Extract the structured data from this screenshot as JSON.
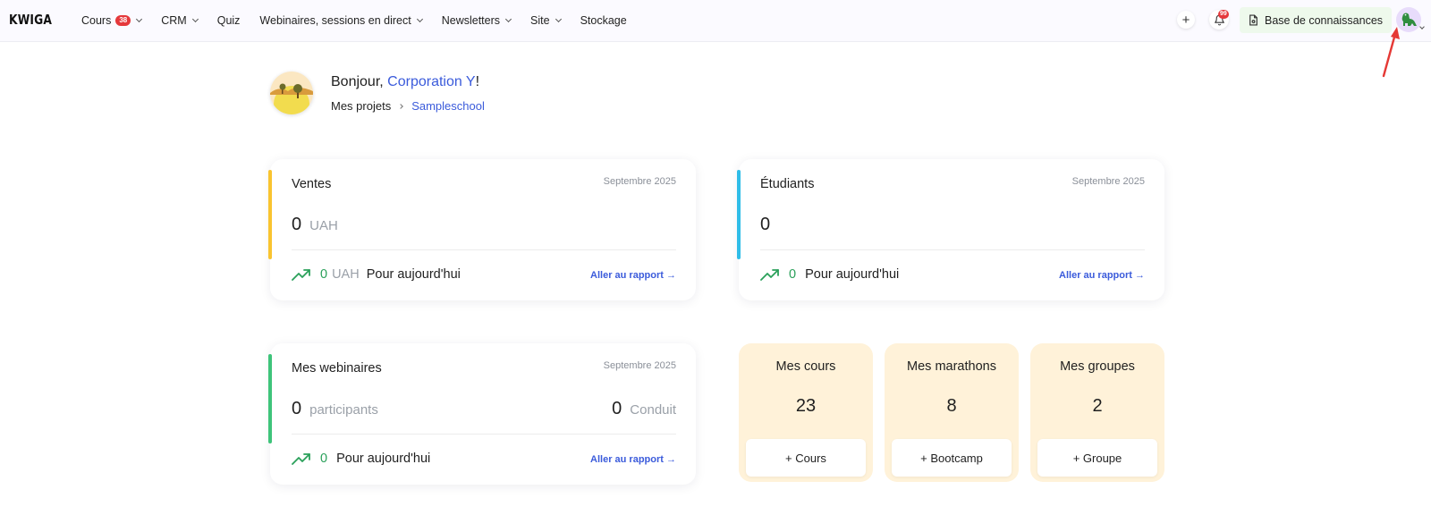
{
  "header": {
    "logo": "KWIGA",
    "nav": [
      {
        "label": "Cours",
        "badge": "38"
      },
      {
        "label": "CRM"
      },
      {
        "label": "Quiz"
      },
      {
        "label": "Webinaires, sessions en direct"
      },
      {
        "label": "Newsletters"
      },
      {
        "label": "Site"
      },
      {
        "label": "Stockage"
      }
    ],
    "add_label": "+",
    "notifications_badge": "99",
    "knowledge_base": "Base de connaissances"
  },
  "greeting": {
    "hello": "Bonjour, ",
    "name": "Corporation Y",
    "exclaim": "!",
    "breadcrumb_root": "Mes projets",
    "breadcrumb_current": "Sampleschool"
  },
  "sales": {
    "title": "Ventes",
    "period": "Septembre 2025",
    "amount": "0",
    "currency": "UAH",
    "today_value": "0",
    "today_unit": "UAH",
    "today_label": "Pour aujourd'hui",
    "report_link": "Aller au rapport →",
    "accent": "#f9c430"
  },
  "students": {
    "title": "Étudiants",
    "period": "Septembre 2025",
    "count": "0",
    "today_value": "0",
    "today_label": "Pour aujourd'hui",
    "report_link": "Aller au rapport →",
    "accent": "#2fbde8"
  },
  "webinars": {
    "title": "Mes webinaires",
    "period": "Septembre 2025",
    "participants_value": "0",
    "participants_label": "participants",
    "conducted_value": "0",
    "conducted_label": "Conduit",
    "today_value": "0",
    "today_label": "Pour aujourd'hui",
    "report_link": "Aller au rapport →",
    "accent": "#3ec47a"
  },
  "stats": [
    {
      "label": "Mes cours",
      "value": "23",
      "button": "+ Cours"
    },
    {
      "label": "Mes marathons",
      "value": "8",
      "button": "+ Bootcamp"
    },
    {
      "label": "Mes groupes",
      "value": "2",
      "button": "+ Groupe"
    }
  ],
  "colors": {
    "link": "#3b5bdb",
    "positive": "#2aa05a",
    "badge": "#e5383b",
    "stat_bg": "#fff2d9"
  }
}
